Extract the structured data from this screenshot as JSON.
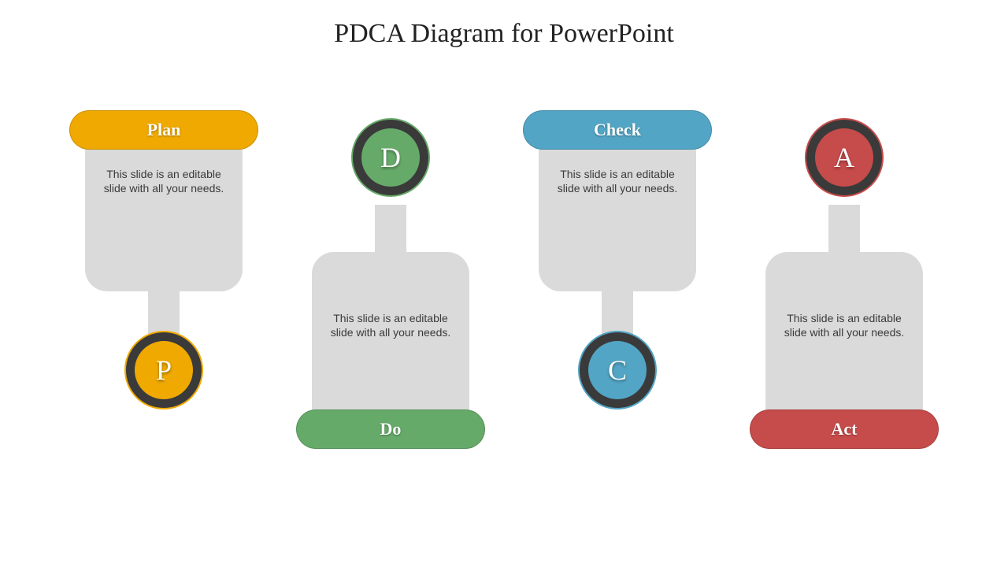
{
  "title": "PDCA Diagram for PowerPoint",
  "steps": [
    {
      "label": "Plan",
      "letter": "P",
      "text": "This slide is an editable slide with all your needs.",
      "color": "#efa900",
      "orient": "top"
    },
    {
      "label": "Do",
      "letter": "D",
      "text": "This slide is an editable slide with all your needs.",
      "color": "#66aa69",
      "orient": "bot"
    },
    {
      "label": "Check",
      "letter": "C",
      "text": "This slide is an editable slide with all your needs.",
      "color": "#52a5c4",
      "orient": "top"
    },
    {
      "label": "Act",
      "letter": "A",
      "text": "This slide is an editable slide with all your needs.",
      "color": "#c64b4b",
      "orient": "bot"
    }
  ]
}
